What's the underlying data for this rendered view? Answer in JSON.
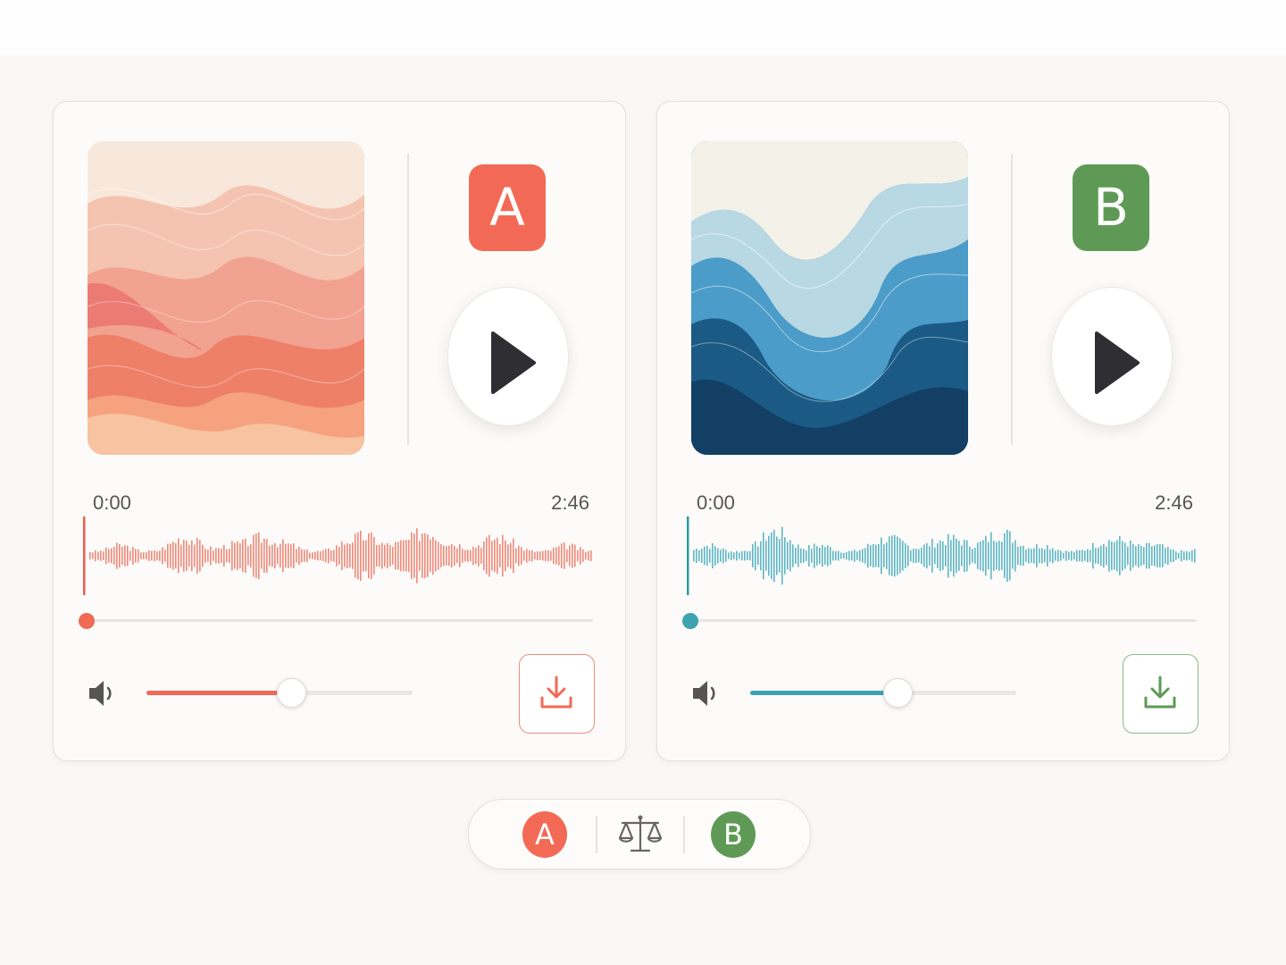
{
  "player_a": {
    "label": "A",
    "time_current": "0:00",
    "time_total": "2:46",
    "accent": "#f26a55",
    "wave_color": "#f08a7a",
    "volume": 0.54,
    "progress": 0
  },
  "player_b": {
    "label": "B",
    "accent": "#5e9a55",
    "wave_color": "#5fb6c4",
    "time_current": "0:00",
    "time_total": "2:46",
    "volume": 0.55,
    "progress": 0
  },
  "compare": {
    "a_label": "A",
    "b_label": "B",
    "icon": "scale-icon"
  },
  "icons": [
    "play-icon",
    "volume-icon",
    "download-icon",
    "scale-icon"
  ]
}
